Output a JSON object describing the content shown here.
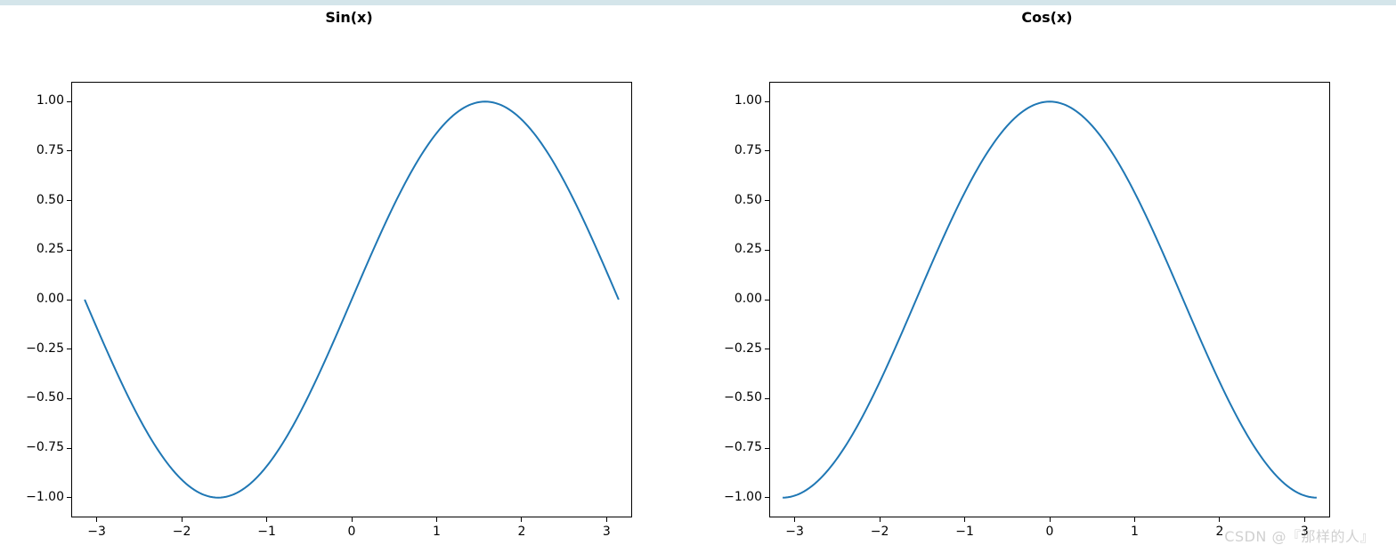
{
  "top_bar_color": "#d4e5ea",
  "line_color": "#1f77b4",
  "watermark": "CSDN @『那样的人』",
  "chart_data": [
    {
      "type": "line",
      "title": "Sin(x)",
      "xlabel": "",
      "ylabel": "",
      "xlim": [
        -3.3,
        3.3
      ],
      "ylim": [
        -1.1,
        1.1
      ],
      "xticks": [
        -3,
        -2,
        -1,
        0,
        1,
        2,
        3
      ],
      "yticks": [
        -1.0,
        -0.75,
        -0.5,
        -0.25,
        0.0,
        0.25,
        0.5,
        0.75,
        1.0
      ],
      "ytick_labels": [
        "−1.00",
        "−0.75",
        "−0.50",
        "−0.25",
        "0.00",
        "0.25",
        "0.50",
        "0.75",
        "1.00"
      ],
      "xtick_labels": [
        "−3",
        "−2",
        "−1",
        "0",
        "1",
        "2",
        "3"
      ],
      "function": "sin",
      "x_range": [
        -3.14159,
        3.14159
      ],
      "n_points": 200
    },
    {
      "type": "line",
      "title": "Cos(x)",
      "xlabel": "",
      "ylabel": "",
      "xlim": [
        -3.3,
        3.3
      ],
      "ylim": [
        -1.1,
        1.1
      ],
      "xticks": [
        -3,
        -2,
        -1,
        0,
        1,
        2,
        3
      ],
      "yticks": [
        -1.0,
        -0.75,
        -0.5,
        -0.25,
        0.0,
        0.25,
        0.5,
        0.75,
        1.0
      ],
      "ytick_labels": [
        "−1.00",
        "−0.75",
        "−0.50",
        "−0.25",
        "0.00",
        "0.25",
        "0.50",
        "0.75",
        "1.00"
      ],
      "xtick_labels": [
        "−3",
        "−2",
        "−1",
        "0",
        "1",
        "2",
        "3"
      ],
      "function": "cos",
      "x_range": [
        -3.14159,
        3.14159
      ],
      "n_points": 200
    }
  ]
}
